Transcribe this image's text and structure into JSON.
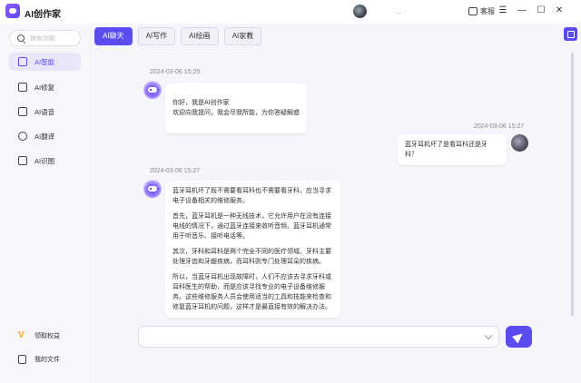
{
  "app": {
    "title": "AI创作家",
    "user_name": "..."
  },
  "titlebar": {
    "service_label": "客服",
    "menu_glyph": "☰",
    "minimize_glyph": "—",
    "maximize_glyph": "☐",
    "close_glyph": "✕"
  },
  "sidebar": {
    "search_placeholder": "搜索功能",
    "items": [
      {
        "label": "AI智能",
        "icon": "robot-icon",
        "active": true
      },
      {
        "label": "AI修复",
        "icon": "repair-icon",
        "active": false
      },
      {
        "label": "AI语音",
        "icon": "voice-icon",
        "active": false
      },
      {
        "label": "AI翻译",
        "icon": "translate-icon",
        "active": false
      },
      {
        "label": "AI识图",
        "icon": "image-recognition-icon",
        "active": false
      }
    ],
    "bottom": [
      {
        "label": "领取权益",
        "icon": "vip-icon"
      },
      {
        "label": "我的文件",
        "icon": "file-icon"
      }
    ]
  },
  "tabs": [
    {
      "label": "AI聊天",
      "active": true
    },
    {
      "label": "AI写作",
      "active": false
    },
    {
      "label": "AI绘画",
      "active": false
    },
    {
      "label": "AI家教",
      "active": false
    }
  ],
  "messages": [
    {
      "sender": "bot",
      "time": "2024-03-06 15:25",
      "paragraphs": [
        "你好，我是AI创作家\n欢迎向我提问，我会尽我所能，为你答疑解惑"
      ]
    },
    {
      "sender": "user",
      "time": "2024-03-06 15:27",
      "paragraphs": [
        "蓝牙耳机坏了是看耳科还是牙科？"
      ]
    },
    {
      "sender": "bot",
      "time": "2024-03-06 15:27",
      "paragraphs": [
        "蓝牙耳机坏了既不需要看耳科也不需要看牙科，应当寻求电子设备相关的维修服务。",
        "首先，蓝牙耳机是一种无线技术，它允许用户在没有连接电线的情况下，通过蓝牙连接来收听音频。蓝牙耳机通常用于听音乐、接听电话等。",
        "其次，牙科和耳科是两个完全不同的医疗领域。牙科主要处理牙齿和牙龈疾病，而耳科则专门处理耳朵的疾病。",
        "所以，当蓝牙耳机出现故障时，人们不应该去寻求牙科或耳科医生的帮助，而是应该寻找专业的电子设备维修服务。这些维修服务人员会使用适当的工具和技能来检查和修复蓝牙耳机的问题，这样才是最直接有效的解决办法。"
      ]
    }
  ],
  "composer": {
    "placeholder": ""
  },
  "colors": {
    "accent": "#5b4cf0",
    "background": "#f6f5fc"
  }
}
